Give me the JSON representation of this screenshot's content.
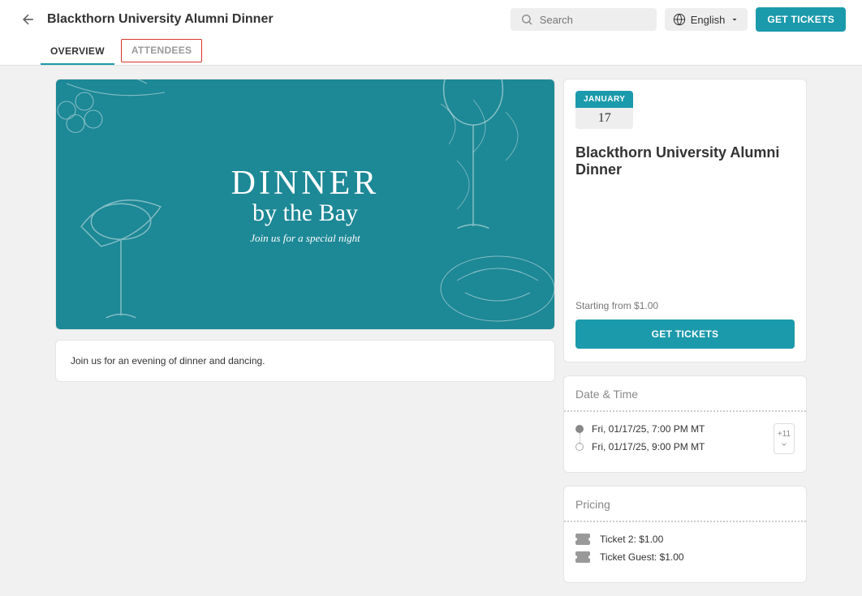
{
  "header": {
    "title": "Blackthorn University Alumni Dinner",
    "search_placeholder": "Search",
    "language": "English",
    "get_tickets": "GET TICKETS"
  },
  "tabs": {
    "overview": "OVERVIEW",
    "attendees": "ATTENDEES"
  },
  "hero": {
    "line1": "DINNER",
    "line2": "by the Bay",
    "line3": "Join us for a special night"
  },
  "description": "Join us for an evening of dinner and dancing.",
  "event": {
    "month": "JANUARY",
    "day": "17",
    "title": "Blackthorn University Alumni Dinner",
    "price_from": "Starting from $1.00",
    "get_tickets": "GET TICKETS"
  },
  "datetime": {
    "heading": "Date & Time",
    "start": "Fri, 01/17/25, 7:00 PM MT",
    "end": "Fri, 01/17/25, 9:00 PM MT",
    "cal_label": "+11"
  },
  "pricing": {
    "heading": "Pricing",
    "items": [
      "Ticket 2: $1.00",
      "Ticket Guest: $1.00"
    ]
  }
}
